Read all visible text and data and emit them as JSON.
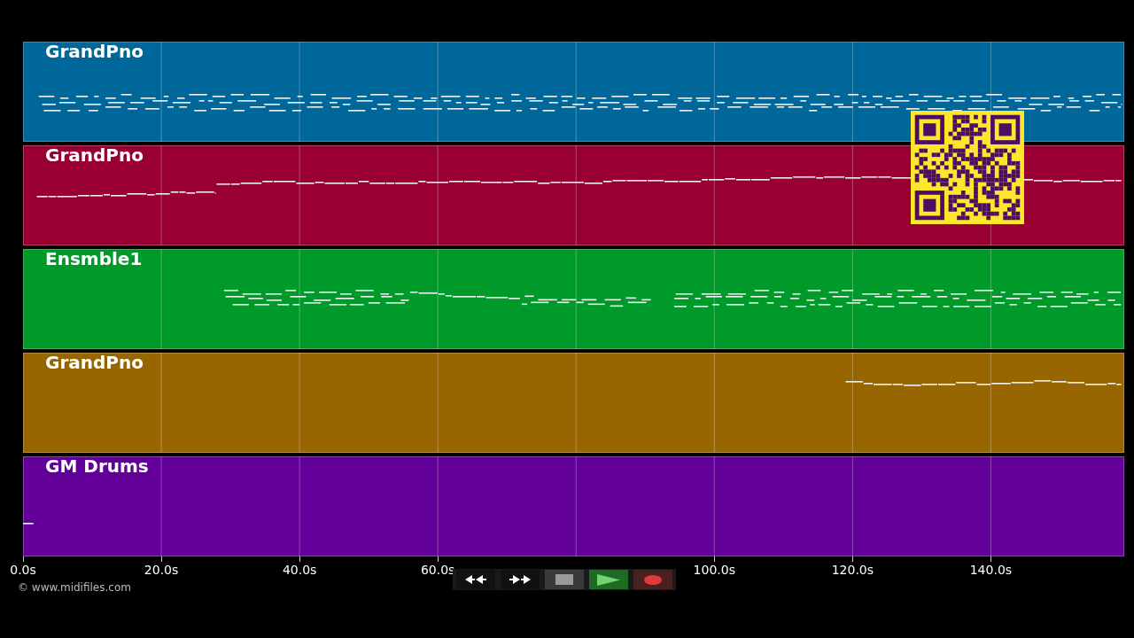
{
  "tracks": [
    {
      "name": "GrandPno",
      "color": "#00679b"
    },
    {
      "name": "GrandPno",
      "color": "#990031"
    },
    {
      "name": "Ensmble1",
      "color": "#009a2b"
    },
    {
      "name": "GrandPno",
      "color": "#986600"
    },
    {
      "name": "GM Drums",
      "color": "#630099"
    }
  ],
  "axis_ticks_before_transport": [
    "0.0s",
    "20.0s",
    "40.0s",
    "60.0s"
  ],
  "axis_ticks_after_transport": [
    "100.0s",
    "120.0s",
    "140.0s"
  ],
  "credit": "© www.midifiles.com",
  "transport": [
    {
      "kind": "rewind"
    },
    {
      "kind": "forward"
    },
    {
      "kind": "stop"
    },
    {
      "kind": "play"
    },
    {
      "kind": "record"
    }
  ]
}
